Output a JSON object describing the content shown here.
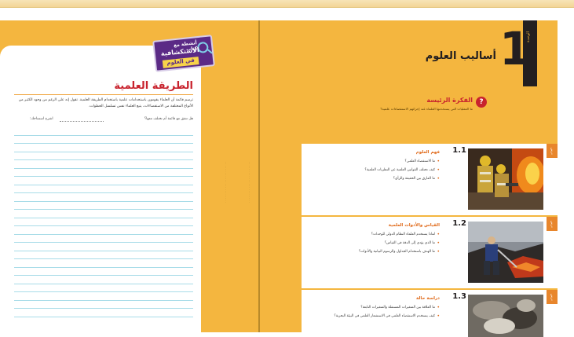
{
  "left_page": {
    "badge": {
      "line1": "أنشطة مع كتاب",
      "line2": "الاستكشافية",
      "line3": "في العلوم",
      "icon": "magnifier-icon"
    },
    "title": "الطريقة العلمية",
    "intro": "ترسم قائمة أن العلماء يقومون باستخدامات علمية باستخدام الطريقة العلمية. تقول إنه على الرغم من وجود الكثير من الأنواع المختلفة من الاستقصاءات، يتبع العلماء نفس تسلسل الخطوات.",
    "question": "هل تتفق مع قائمة أم تختلف معها؟",
    "explain_label": "اشرح استنتاجك:"
  },
  "chapter": {
    "tab_label": "الوحدة",
    "number": "1",
    "title": "أساليب العلوم"
  },
  "big_idea": {
    "icon": "?",
    "label": "الفكرة الرئيسة",
    "text": "ما العمليات التي يستخدمها العلماء عند إجرائهم الاستقصاءات علمية؟"
  },
  "lessons": [
    {
      "tag": "درس",
      "number": "1.1",
      "title": "فهم العلوم",
      "questions": [
        "ما الاستقصاء العلمي؟",
        "كيف تختلف القوانين العلمية عن النظريات العلمية؟",
        "ما الفارق بين الحقيقة والرأي؟"
      ],
      "photo": "firefighters-photo"
    },
    {
      "tag": "درس",
      "number": "1.2",
      "title": "القياس والأدوات العلمية",
      "questions": [
        "لماذا يستخدم العلماء النظام الدولي للوحدات؟",
        "ما الذي يؤدي إلى الدقة في القياس؟",
        "ما الهدف باستخدام الجداول والرسوم البيانية والأدوات؟"
      ],
      "photo": "volcano-scientist-photo"
    },
    {
      "tag": "درس",
      "number": "1.3",
      "title": "دراسة حالة",
      "questions": [
        "ما العلاقة بين المتغيرات المستقلة والمتغيرات التابعة؟",
        "كيف يستخدم الاستقصاء العلمي في الاستشعار العلمي في البيئة البحرية؟"
      ],
      "photo": "oil-spill-photo"
    }
  ]
}
